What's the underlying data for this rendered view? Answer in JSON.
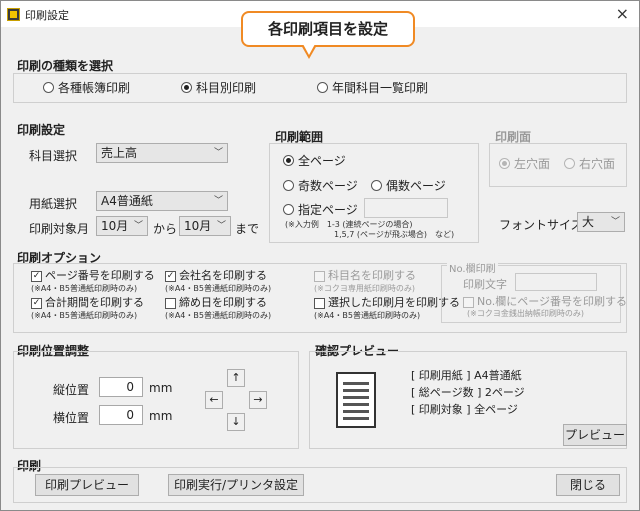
{
  "window": {
    "title": "印刷設定",
    "close_label": "×"
  },
  "callout": {
    "text": "各印刷項目を設定"
  },
  "print_type": {
    "title": "印刷の種類を選択",
    "options": [
      "各種帳簿印刷",
      "科目別印刷",
      "年間科目一覧印刷"
    ],
    "selected": 1
  },
  "print_settings": {
    "title": "印刷設定",
    "account_label": "科目選択",
    "account_value": "売上高",
    "paper_label": "用紙選択",
    "paper_value": "A4普通紙",
    "month_label": "印刷対象月",
    "from_month": "10月",
    "from_label": "から",
    "to_month": "10月",
    "to_label": "まで"
  },
  "print_range": {
    "title": "印刷範囲",
    "options": [
      "全ページ",
      "奇数ページ",
      "偶数ページ",
      "指定ページ"
    ],
    "selected": 0,
    "note1": "(※入力例　1-3 (連続ページの場合)",
    "note2": "1,5,7 (ページが飛ぶ場合)　など)"
  },
  "print_side": {
    "title": "印刷面",
    "options": [
      "左穴面",
      "右穴面"
    ],
    "selected": 0
  },
  "font_size": {
    "label": "フォントサイズ",
    "value": "大"
  },
  "print_options": {
    "title": "印刷オプション",
    "items": [
      {
        "label": "ページ番号を印刷する",
        "note": "(※A4・B5普通紙印刷時のみ)",
        "checked": true,
        "enabled": true
      },
      {
        "label": "会社名を印刷する",
        "note": "(※A4・B5普通紙印刷時のみ)",
        "checked": true,
        "enabled": true
      },
      {
        "label": "科目名を印刷する",
        "note": "(※コクヨ専用紙印刷時のみ)",
        "checked": false,
        "enabled": false
      },
      {
        "label": "合計期間を印刷する",
        "note": "(※A4・B5普通紙印刷時のみ)",
        "checked": true,
        "enabled": true
      },
      {
        "label": "締め日を印刷する",
        "note": "(※A4・B5普通紙印刷時のみ)",
        "checked": false,
        "enabled": true
      },
      {
        "label": "選択した印刷月を印刷する",
        "note": "(※A4・B5普通紙印刷時のみ)",
        "checked": false,
        "enabled": true
      }
    ],
    "no_print": {
      "title": "No.欄印刷",
      "text_label": "印刷文字",
      "check_label": "No.欄にページ番号を印刷する",
      "check_note": "(※コクヨ金銭出納帳印刷時のみ)"
    }
  },
  "position": {
    "title": "印刷位置調整",
    "vertical_label": "縦位置",
    "vertical_value": "0",
    "horizontal_label": "横位置",
    "horizontal_value": "0",
    "unit": "mm",
    "arrows": {
      "up": "↑",
      "left": "←",
      "right": "→",
      "down": "↓"
    }
  },
  "preview": {
    "title": "確認プレビュー",
    "paper_info": "[ 印刷用紙 ] A4普通紙",
    "pages_info": "[ 総ページ数 ] 2ページ",
    "target_info": "[ 印刷対象 ] 全ページ",
    "button": "プレビュー"
  },
  "print_section": {
    "title": "印刷",
    "preview_button": "印刷プレビュー",
    "execute_button": "印刷実行/プリンタ設定",
    "close_button": "閉じる"
  }
}
